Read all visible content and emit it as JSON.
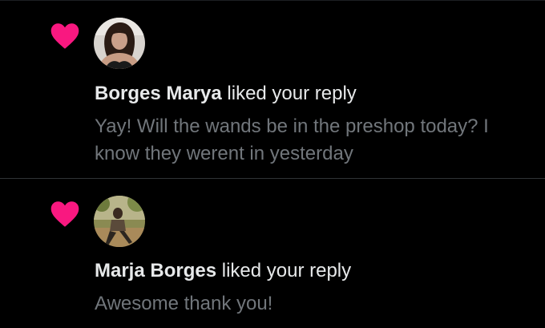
{
  "colors": {
    "background": "#000000",
    "heart": "#f91880",
    "primary_text": "#e7e9ea",
    "secondary_text": "#71767b",
    "divider": "#2f3336"
  },
  "notifications": [
    {
      "icon": "heart-icon",
      "user_name": "Borges Marya",
      "action": "liked your reply",
      "preview": "Yay! Will the wands be in the preshop today? I know they werent in yesterday"
    },
    {
      "icon": "heart-icon",
      "user_name": "Marja Borges",
      "action": "liked your reply",
      "preview": "Awesome thank you!"
    }
  ]
}
